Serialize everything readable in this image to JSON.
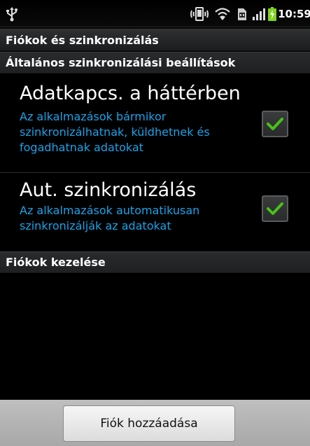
{
  "status_bar": {
    "time": "10:59",
    "icons": [
      "usb-icon",
      "vibrate-icon",
      "wifi-icon",
      "sd-card-icon",
      "signal-icon",
      "battery-charging-icon"
    ]
  },
  "screen": {
    "title": "Fiókok és szinkronizálás"
  },
  "general_sync": {
    "header": "Általános szinkronizálási beállítások",
    "background_data": {
      "title": "Adatkapcs. a háttérben",
      "summary": "Az alkalmazások bármikor szinkronizálhatnak, küldhetnek és fogadhatnak adatokat",
      "checked": true
    },
    "auto_sync": {
      "title": "Aut. szinkronizálás",
      "summary": "Az alkalmazások automatikusan szinkronizálják az adatokat",
      "checked": true
    }
  },
  "manage_accounts": {
    "header": "Fiókok kezelése"
  },
  "bottom_bar": {
    "add_account_label": "Fiók hozzáadása"
  },
  "colors": {
    "summary_text": "#1aa3e8",
    "check_green": "#46c21a"
  }
}
